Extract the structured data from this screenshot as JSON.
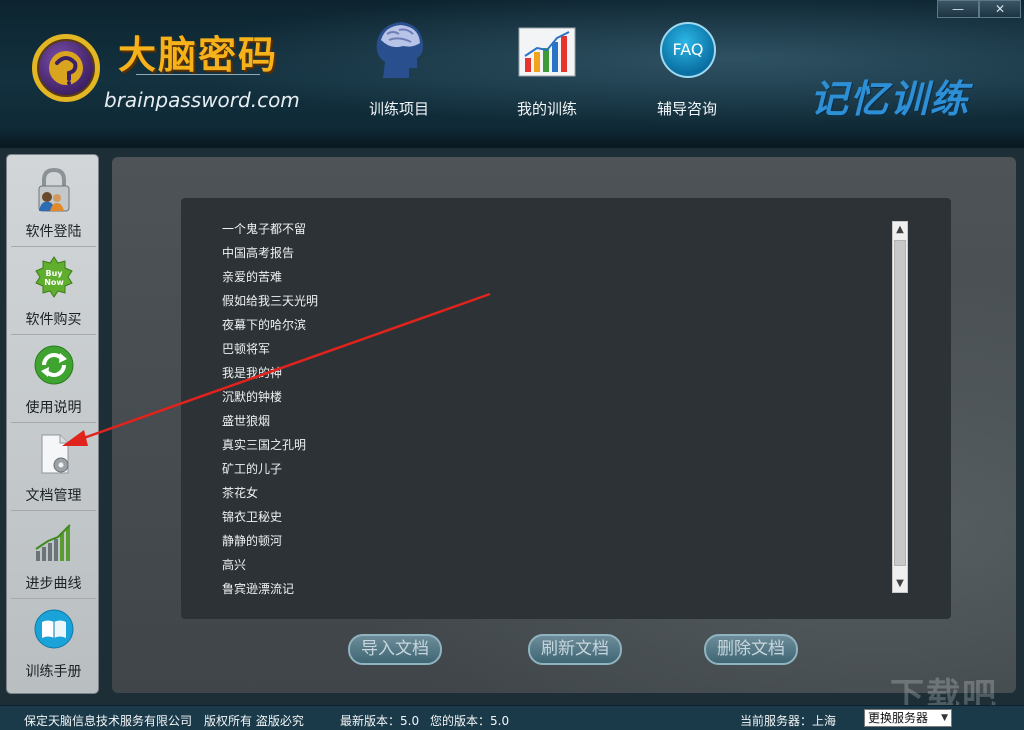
{
  "window": {
    "minimize_label": "—",
    "close_label": "✕"
  },
  "header": {
    "logo_cn": "大脑密码",
    "logo_url": "brainpassword.com",
    "slogan": "记忆训练",
    "nav": [
      {
        "label": "训练项目",
        "icon": "brain-head-icon"
      },
      {
        "label": "我的训练",
        "icon": "bar-chart-icon"
      },
      {
        "label": "辅导咨询",
        "icon": "faq-icon",
        "icon_text": "FAQ"
      }
    ]
  },
  "sidebar": {
    "items": [
      {
        "label": "软件登陆",
        "icon": "lock-user-icon"
      },
      {
        "label": "软件购买",
        "icon": "buy-now-icon",
        "icon_text": "Buy Now"
      },
      {
        "label": "使用说明",
        "icon": "refresh-icon"
      },
      {
        "label": "文档管理",
        "icon": "document-gear-icon"
      },
      {
        "label": "进步曲线",
        "icon": "progress-chart-icon"
      },
      {
        "label": "训练手册",
        "icon": "book-icon"
      }
    ]
  },
  "documents": [
    "一个鬼子都不留",
    "中国高考报告",
    "亲爱的苦难",
    "假如给我三天光明",
    "夜幕下的哈尔滨",
    "巴顿将军",
    "我是我的神",
    "沉默的钟楼",
    "盛世狼烟",
    "真实三国之孔明",
    "矿工的儿子",
    "茶花女",
    "锦衣卫秘史",
    "静静的顿河",
    "高兴",
    "鲁宾逊漂流记"
  ],
  "actions": {
    "import": "导入文档",
    "refresh": "刷新文档",
    "delete": "删除文档"
  },
  "status": {
    "company": "保定天脑信息技术服务有限公司",
    "copyright": "版权所有 盗版必究",
    "latest_version": "最新版本：5.0",
    "your_version": "您的版本：5.0",
    "current_server": "当前服务器：上海",
    "change_server": "更换服务器"
  },
  "watermark": "下载吧",
  "colors": {
    "accent_orange": "#f6b21a",
    "slogan_blue": "#2d8fd6",
    "annotation_red": "#e0231c"
  }
}
